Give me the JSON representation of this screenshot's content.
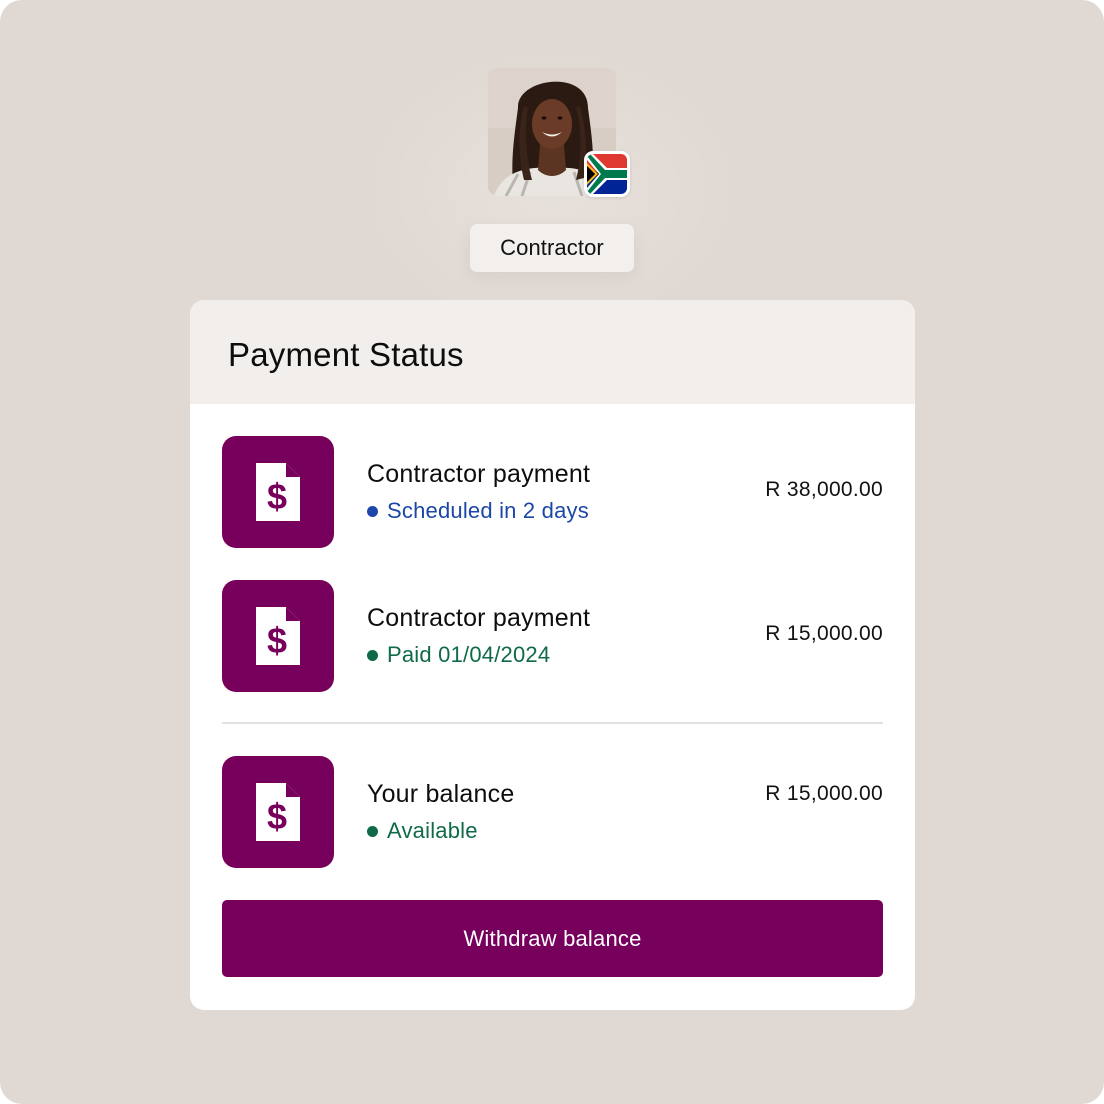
{
  "profile": {
    "role": "Contractor",
    "flag_icon": "south-africa-flag-icon"
  },
  "colors": {
    "background": "#e0d8d2",
    "brand": "#76005b",
    "scheduled": "#1c47a8",
    "paid": "#0f6b47"
  },
  "card": {
    "title": "Payment Status",
    "items": [
      {
        "icon": "invoice-dollar-icon",
        "title": "Contractor payment",
        "status": "Scheduled in 2 days",
        "status_color": "#1c47a8",
        "amount": "R 38,000.00"
      },
      {
        "icon": "invoice-dollar-icon",
        "title": "Contractor payment",
        "status": "Paid 01/04/2024",
        "status_color": "#0f6b47",
        "amount": "R 15,000.00"
      }
    ],
    "balance": {
      "icon": "invoice-dollar-icon",
      "title": "Your balance",
      "status": "Available",
      "status_color": "#0f6b47",
      "amount": "R 15,000.00"
    },
    "withdraw_label": "Withdraw balance"
  }
}
